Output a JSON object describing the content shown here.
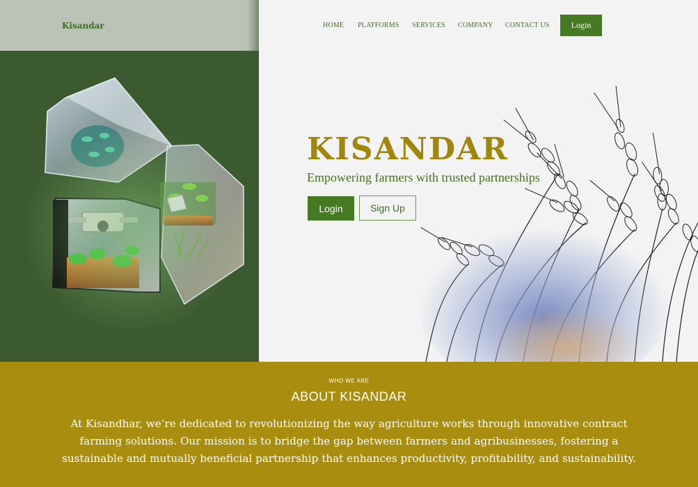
{
  "nav": {
    "brand": "Kisandar",
    "items": [
      {
        "label": "HOME",
        "key": "home"
      },
      {
        "label": "PLATFORMS",
        "key": "platforms"
      },
      {
        "label": "SERVICES",
        "key": "services"
      },
      {
        "label": "COMPANY",
        "key": "company"
      },
      {
        "label": "CONTACT US",
        "key": "contact"
      }
    ],
    "login_label": "Login"
  },
  "hero": {
    "title": "KISANDAR",
    "subtitle": "Empowering farmers with trusted partnerships",
    "login_label": "Login",
    "signup_label": "Sign Up"
  },
  "about": {
    "eyebrow": "WHO WE ARE",
    "title": "ABOUT KISANDAR",
    "body": "At Kisandhar, we’re dedicated to revolutionizing the way agriculture works through innovative contract farming solutions. Our mission is to bridge the gap between farmers and agribusinesses, fostering a sustainable and mutually beneficial partnership that enhances productivity, profitability, and sustainability."
  },
  "colors": {
    "brand_green": "#457a22",
    "panel_green": "#3c5a30",
    "gold": "#a98d0e",
    "title_gold": "#9f860d"
  },
  "icons": {
    "hero_illustration": "glass-cubes-farm-icon",
    "wheat_illustration": "wheat-icon"
  }
}
